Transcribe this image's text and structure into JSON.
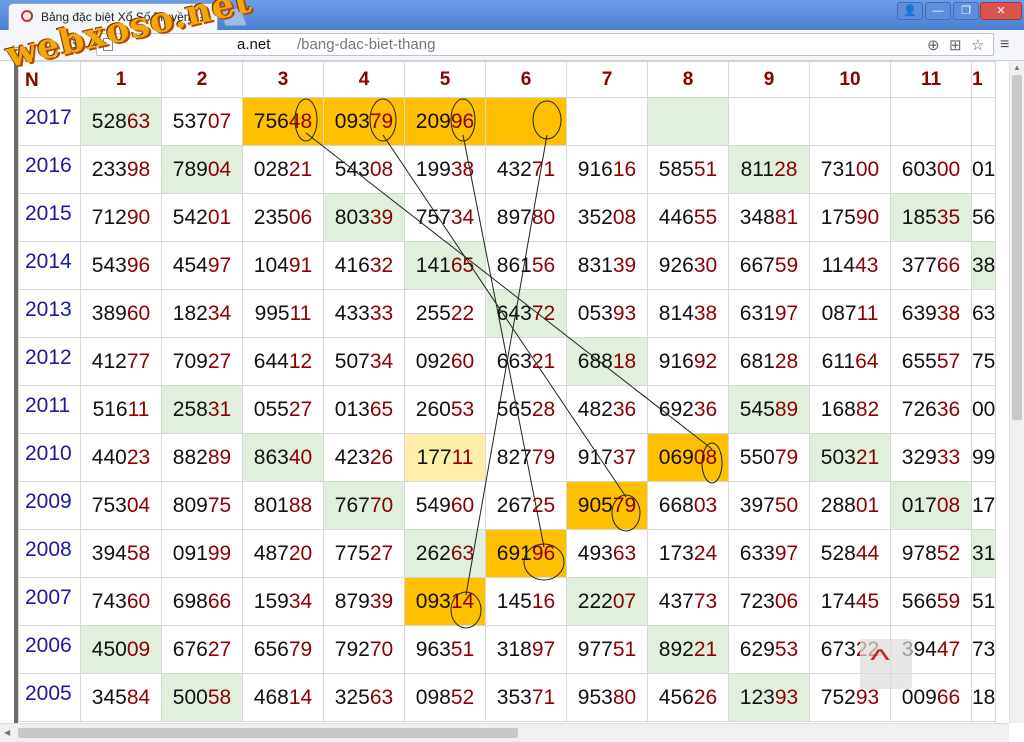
{
  "tab": {
    "title": "Bảng đặc biệt Xổ Số Truyền",
    "close": "×"
  },
  "window": {
    "user": "👤",
    "minimize": "—",
    "maximize": "❐",
    "close": "✕"
  },
  "toolbar": {
    "back": "←",
    "forward": "→",
    "reload": "⟳",
    "url_host": "a.net",
    "url_path": "/bang-dac-biet-thang",
    "zoom_icon": "⊕",
    "translate_icon": "⊞",
    "bookmark_icon": "☆",
    "menu_icon": "≡"
  },
  "watermark": "webxoso.net",
  "colors": {
    "green": "#e0f0dc",
    "orange": "#ffc000",
    "yellow": "#ffeeaa",
    "year": "#1a1aa0",
    "red": "#8b0000"
  },
  "table": {
    "corner": "N",
    "headers": [
      "1",
      "2",
      "3",
      "4",
      "5",
      "6",
      "7",
      "8",
      "9",
      "10",
      "11",
      "1"
    ],
    "rows": [
      {
        "year": "2017",
        "cells": [
          [
            "528",
            "63",
            "g"
          ],
          [
            "537",
            "07",
            ""
          ],
          [
            "756",
            "48",
            "o"
          ],
          [
            "093",
            "79",
            "o"
          ],
          [
            "209",
            "96",
            "o"
          ],
          [
            "",
            "",
            "o"
          ],
          [
            "",
            "",
            ""
          ],
          [
            "",
            "",
            "g"
          ],
          [
            "",
            "",
            ""
          ],
          [
            "",
            "",
            ""
          ],
          [
            "",
            "",
            ""
          ],
          [
            "",
            "",
            ""
          ]
        ]
      },
      {
        "year": "2016",
        "cells": [
          [
            "233",
            "98",
            ""
          ],
          [
            "789",
            "04",
            "g"
          ],
          [
            "028",
            "21",
            ""
          ],
          [
            "543",
            "08",
            ""
          ],
          [
            "199",
            "38",
            ""
          ],
          [
            "432",
            "71",
            ""
          ],
          [
            "916",
            "16",
            ""
          ],
          [
            "585",
            "51",
            ""
          ],
          [
            "811",
            "28",
            "g"
          ],
          [
            "731",
            "00",
            ""
          ],
          [
            "603",
            "00",
            ""
          ],
          [
            "01",
            "",
            ""
          ]
        ]
      },
      {
        "year": "2015",
        "cells": [
          [
            "712",
            "90",
            ""
          ],
          [
            "542",
            "01",
            ""
          ],
          [
            "235",
            "06",
            ""
          ],
          [
            "803",
            "39",
            "g"
          ],
          [
            "757",
            "34",
            ""
          ],
          [
            "897",
            "80",
            ""
          ],
          [
            "352",
            "08",
            ""
          ],
          [
            "446",
            "55",
            ""
          ],
          [
            "348",
            "81",
            ""
          ],
          [
            "175",
            "90",
            ""
          ],
          [
            "185",
            "35",
            "g"
          ],
          [
            "56",
            "",
            ""
          ]
        ]
      },
      {
        "year": "2014",
        "cells": [
          [
            "543",
            "96",
            ""
          ],
          [
            "454",
            "97",
            ""
          ],
          [
            "104",
            "91",
            ""
          ],
          [
            "416",
            "32",
            ""
          ],
          [
            "141",
            "65",
            "g"
          ],
          [
            "861",
            "56",
            ""
          ],
          [
            "831",
            "39",
            ""
          ],
          [
            "926",
            "30",
            ""
          ],
          [
            "667",
            "59",
            ""
          ],
          [
            "114",
            "43",
            ""
          ],
          [
            "377",
            "66",
            ""
          ],
          [
            "38",
            "",
            "g"
          ]
        ]
      },
      {
        "year": "2013",
        "cells": [
          [
            "389",
            "60",
            ""
          ],
          [
            "182",
            "34",
            ""
          ],
          [
            "995",
            "11",
            ""
          ],
          [
            "433",
            "33",
            ""
          ],
          [
            "255",
            "22",
            ""
          ],
          [
            "643",
            "72",
            "g"
          ],
          [
            "053",
            "93",
            ""
          ],
          [
            "814",
            "38",
            ""
          ],
          [
            "631",
            "97",
            ""
          ],
          [
            "087",
            "11",
            ""
          ],
          [
            "639",
            "38",
            ""
          ],
          [
            "63",
            "",
            ""
          ]
        ]
      },
      {
        "year": "2012",
        "cells": [
          [
            "412",
            "77",
            ""
          ],
          [
            "709",
            "27",
            ""
          ],
          [
            "644",
            "12",
            ""
          ],
          [
            "507",
            "34",
            ""
          ],
          [
            "092",
            "60",
            ""
          ],
          [
            "663",
            "21",
            ""
          ],
          [
            "688",
            "18",
            "g"
          ],
          [
            "916",
            "92",
            ""
          ],
          [
            "681",
            "28",
            ""
          ],
          [
            "611",
            "64",
            ""
          ],
          [
            "655",
            "57",
            ""
          ],
          [
            "75",
            "",
            ""
          ]
        ]
      },
      {
        "year": "2011",
        "cells": [
          [
            "516",
            "11",
            ""
          ],
          [
            "258",
            "31",
            "g"
          ],
          [
            "055",
            "27",
            ""
          ],
          [
            "013",
            "65",
            ""
          ],
          [
            "260",
            "53",
            ""
          ],
          [
            "565",
            "28",
            ""
          ],
          [
            "482",
            "36",
            ""
          ],
          [
            "692",
            "36",
            ""
          ],
          [
            "545",
            "89",
            "g"
          ],
          [
            "168",
            "82",
            ""
          ],
          [
            "726",
            "36",
            ""
          ],
          [
            "00",
            "",
            ""
          ]
        ]
      },
      {
        "year": "2010",
        "cells": [
          [
            "440",
            "23",
            ""
          ],
          [
            "882",
            "89",
            ""
          ],
          [
            "863",
            "40",
            "g"
          ],
          [
            "423",
            "26",
            ""
          ],
          [
            "177",
            "11",
            "y"
          ],
          [
            "827",
            "79",
            ""
          ],
          [
            "917",
            "37",
            ""
          ],
          [
            "069",
            "08",
            "o"
          ],
          [
            "550",
            "79",
            ""
          ],
          [
            "503",
            "21",
            "g"
          ],
          [
            "329",
            "33",
            ""
          ],
          [
            "99",
            "",
            ""
          ]
        ]
      },
      {
        "year": "2009",
        "cells": [
          [
            "753",
            "04",
            ""
          ],
          [
            "809",
            "75",
            ""
          ],
          [
            "801",
            "88",
            ""
          ],
          [
            "767",
            "70",
            "g"
          ],
          [
            "549",
            "60",
            ""
          ],
          [
            "267",
            "25",
            ""
          ],
          [
            "905",
            "79",
            "o"
          ],
          [
            "668",
            "03",
            ""
          ],
          [
            "397",
            "50",
            ""
          ],
          [
            "288",
            "01",
            ""
          ],
          [
            "017",
            "08",
            "g"
          ],
          [
            "17",
            "",
            ""
          ]
        ]
      },
      {
        "year": "2008",
        "cells": [
          [
            "394",
            "58",
            ""
          ],
          [
            "091",
            "99",
            ""
          ],
          [
            "487",
            "20",
            ""
          ],
          [
            "775",
            "27",
            ""
          ],
          [
            "262",
            "63",
            "g"
          ],
          [
            "691",
            "96",
            "o"
          ],
          [
            "493",
            "63",
            ""
          ],
          [
            "173",
            "24",
            ""
          ],
          [
            "633",
            "97",
            ""
          ],
          [
            "528",
            "44",
            ""
          ],
          [
            "978",
            "52",
            ""
          ],
          [
            "31",
            "",
            "g"
          ]
        ]
      },
      {
        "year": "2007",
        "cells": [
          [
            "743",
            "60",
            ""
          ],
          [
            "698",
            "66",
            ""
          ],
          [
            "159",
            "34",
            ""
          ],
          [
            "879",
            "39",
            ""
          ],
          [
            "093",
            "14",
            "o"
          ],
          [
            "145",
            "16",
            ""
          ],
          [
            "222",
            "07",
            "g"
          ],
          [
            "437",
            "73",
            ""
          ],
          [
            "723",
            "06",
            ""
          ],
          [
            "174",
            "45",
            ""
          ],
          [
            "566",
            "59",
            ""
          ],
          [
            "51",
            "",
            ""
          ]
        ]
      },
      {
        "year": "2006",
        "cells": [
          [
            "450",
            "09",
            "g"
          ],
          [
            "676",
            "27",
            ""
          ],
          [
            "656",
            "79",
            ""
          ],
          [
            "792",
            "70",
            ""
          ],
          [
            "963",
            "51",
            ""
          ],
          [
            "318",
            "97",
            ""
          ],
          [
            "977",
            "51",
            ""
          ],
          [
            "892",
            "21",
            "g"
          ],
          [
            "629",
            "53",
            ""
          ],
          [
            "673",
            "22",
            ""
          ],
          [
            "394",
            "47",
            ""
          ],
          [
            "73",
            "",
            ""
          ]
        ]
      },
      {
        "year": "2005",
        "cells": [
          [
            "345",
            "84",
            ""
          ],
          [
            "500",
            "58",
            "g"
          ],
          [
            "468",
            "14",
            ""
          ],
          [
            "325",
            "63",
            ""
          ],
          [
            "098",
            "52",
            ""
          ],
          [
            "353",
            "71",
            ""
          ],
          [
            "953",
            "80",
            ""
          ],
          [
            "456",
            "26",
            ""
          ],
          [
            "123",
            "93",
            "g"
          ],
          [
            "752",
            "93",
            ""
          ],
          [
            "009",
            "66",
            ""
          ],
          [
            "18",
            "",
            ""
          ]
        ]
      }
    ]
  },
  "back_to_top": "^"
}
